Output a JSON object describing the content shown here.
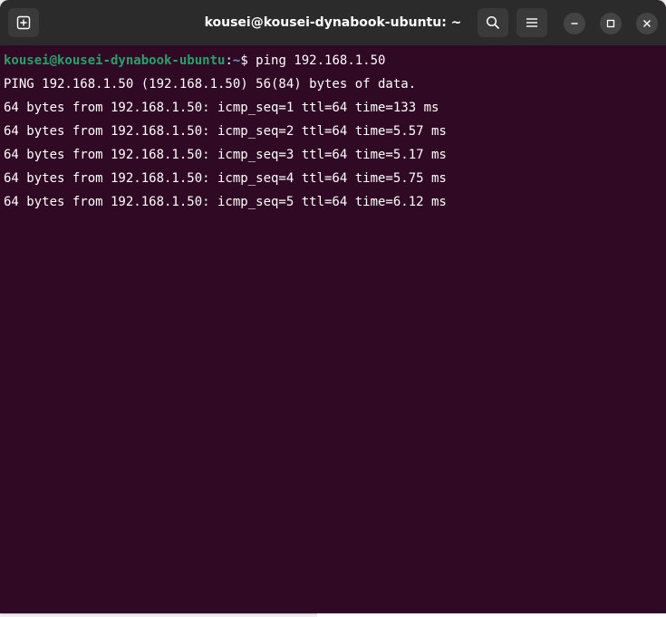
{
  "window": {
    "title": "kousei@kousei-dynabook-ubuntu: ~"
  },
  "icons": {
    "new_tab": "new-tab-icon",
    "search": "search-icon",
    "menu": "hamburger-menu-icon",
    "minimize": "minimize-icon",
    "maximize": "maximize-icon",
    "close": "close-icon"
  },
  "colors": {
    "terminal_bg": "#300a24",
    "titlebar_bg": "#2b2b2b",
    "prompt_user": "#26a269",
    "prompt_path": "#6b9bd2"
  },
  "prompt": {
    "user_host": "kousei@kousei-dynabook-ubuntu",
    "separator": ":",
    "path": "~",
    "symbol": "$ ",
    "command": "ping 192.168.1.50"
  },
  "output": [
    "PING 192.168.1.50 (192.168.1.50) 56(84) bytes of data.",
    "64 bytes from 192.168.1.50: icmp_seq=1 ttl=64 time=133 ms",
    "64 bytes from 192.168.1.50: icmp_seq=2 ttl=64 time=5.57 ms",
    "64 bytes from 192.168.1.50: icmp_seq=3 ttl=64 time=5.17 ms",
    "64 bytes from 192.168.1.50: icmp_seq=4 ttl=64 time=5.75 ms",
    "64 bytes from 192.168.1.50: icmp_seq=5 ttl=64 time=6.12 ms"
  ]
}
